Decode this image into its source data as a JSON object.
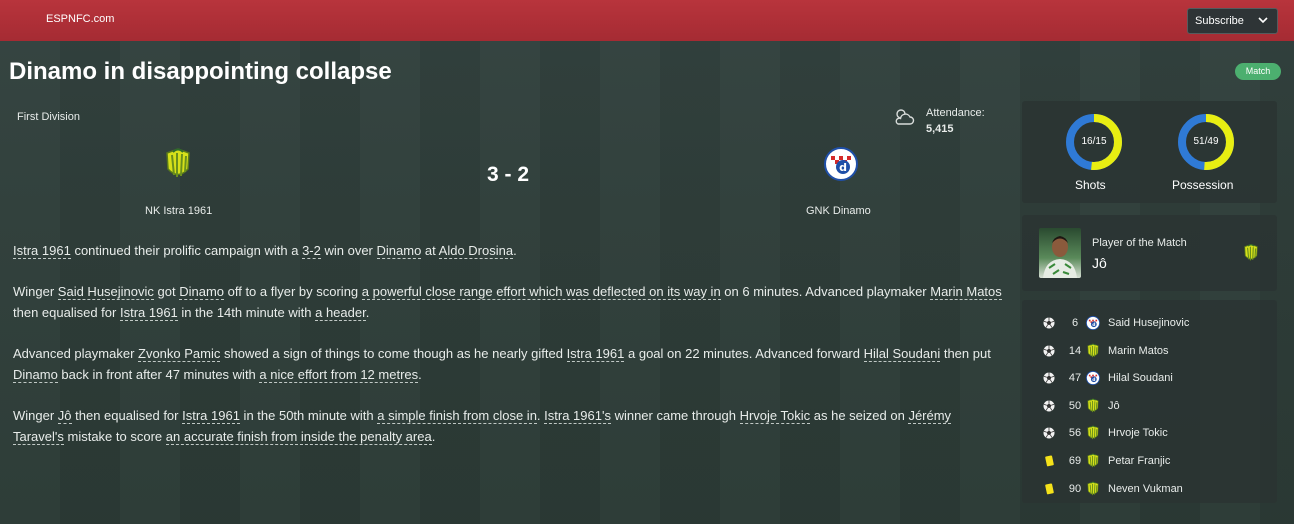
{
  "header": {
    "site": "ESPNFC.com",
    "subscribe_label": "Subscribe"
  },
  "article": {
    "title": "Dinamo in disappointing collapse",
    "badge": "Match"
  },
  "match": {
    "competition": "First Division",
    "attendance_label": "Attendance:",
    "attendance": "5,415",
    "score": "3 - 2",
    "home": "NK Istra 1961",
    "away": "GNK Dinamo",
    "colors": {
      "home": "#d6e01a",
      "away": "#1f4fa8"
    }
  },
  "report": {
    "p1": {
      "t1": "Istra 1961",
      "t2": " continued their prolific campaign with a ",
      "t3": "3-2",
      "t4": " win over ",
      "t5": "Dinamo",
      "t6": " at ",
      "t7": "Aldo Drosina",
      "t8": "."
    },
    "p2": {
      "t1": "Winger ",
      "t2": "Said Husejinovic",
      "t3": " got ",
      "t4": "Dinamo",
      "t5": " off to a flyer by scoring ",
      "t6": "a powerful close range effort which was deflected on its way in",
      "t7": " on 6 minutes. Advanced playmaker ",
      "t8": "Marin Matos",
      "t9": " then equalised for ",
      "t10": "Istra 1961",
      "t11": " in the 14th minute with ",
      "t12": "a header",
      "t13": "."
    },
    "p3": {
      "t1": "Advanced playmaker ",
      "t2": "Zvonko Pamic",
      "t3": " showed a sign of things to come though as he nearly gifted ",
      "t4": "Istra 1961",
      "t5": " a goal on 22 minutes. Advanced forward ",
      "t6": "Hilal Soudani",
      "t7": " then put ",
      "t8": "Dinamo",
      "t9": " back in front after 47 minutes with ",
      "t10": "a nice effort from 12 metres",
      "t11": "."
    },
    "p4": {
      "t1": "Winger ",
      "t2": "Jô",
      "t3": " then equalised for ",
      "t4": "Istra 1961",
      "t5": " in the 50th minute with ",
      "t6": "a simple finish from close in",
      "t7": ". ",
      "t8": "Istra 1961's",
      "t9": " winner came through ",
      "t10": "Hrvoje Tokic",
      "t11": " as he seized on ",
      "t12": "Jérémy Taravel's",
      "t13": " mistake to score ",
      "t14": "an accurate finish from inside the penalty area",
      "t15": "."
    }
  },
  "stats": {
    "shots": {
      "value": "16/15",
      "label": "Shots",
      "home": 16,
      "away": 15
    },
    "possession": {
      "value": "51/49",
      "label": "Possession",
      "home": 51,
      "away": 49
    },
    "colors": {
      "home": "#e8ee12",
      "away": "#2f7ad6"
    }
  },
  "potm": {
    "label": "Player of the Match",
    "name": "Jô"
  },
  "events": [
    {
      "type": "goal",
      "minute": "6",
      "team": "away",
      "player": "Said Husejinovic"
    },
    {
      "type": "goal",
      "minute": "14",
      "team": "home",
      "player": "Marin Matos"
    },
    {
      "type": "goal",
      "minute": "47",
      "team": "away",
      "player": "Hilal Soudani"
    },
    {
      "type": "goal",
      "minute": "50",
      "team": "home",
      "player": "Jô"
    },
    {
      "type": "goal",
      "minute": "56",
      "team": "home",
      "player": "Hrvoje Tokic"
    },
    {
      "type": "yellow-card",
      "minute": "69",
      "team": "home",
      "player": "Petar Franjic"
    },
    {
      "type": "yellow-card",
      "minute": "90",
      "team": "home",
      "player": "Neven Vukman"
    }
  ]
}
